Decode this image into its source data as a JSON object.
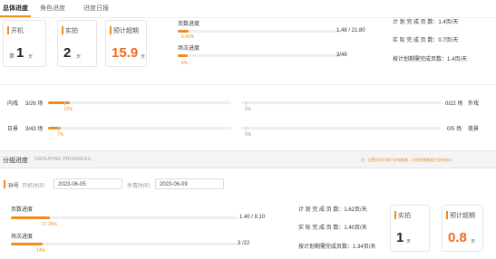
{
  "tabs": [
    "总体进度",
    "角色进度",
    "进度日报"
  ],
  "overview": {
    "card_start": {
      "label": "开机",
      "prefix": "第",
      "value": "1",
      "unit": "天"
    },
    "card_actual": {
      "label": "实拍",
      "value": "2",
      "unit": "天"
    },
    "card_estimate": {
      "label": "预计超期",
      "value": "15.9",
      "unit": "天"
    },
    "page_progress": {
      "label": "页数进度",
      "percent_text": "6.46%",
      "percent": 6.46,
      "count": "1.48 / 21.80"
    },
    "scene_progress": {
      "label": "场次进度",
      "percent_text": "6%",
      "percent": 6,
      "count": "3/48"
    },
    "rates": [
      {
        "label": "计 划 完 成 页 数：",
        "value": "1.4页/天"
      },
      {
        "label": "实 际 完 成 页 数：",
        "value": "0.7页/天"
      },
      {
        "label": "按计划剩需完成页数：",
        "value": "1.4页/天"
      }
    ]
  },
  "timeline": {
    "row1": {
      "left_label": "内戏",
      "left_count": "3/26 场",
      "left_pct_text": "12%",
      "left_pct": 12,
      "right_pct_text": "0%",
      "right_pct": 0,
      "right_count": "0/22 场",
      "right_label": "外戏"
    },
    "row2": {
      "left_label": "日景",
      "left_count": "3/43 场",
      "left_pct_text": "7%",
      "left_pct": 7,
      "right_pct_text": "0%",
      "right_pct": 0,
      "right_count": "0/5 场",
      "right_label": "夜景"
    }
  },
  "grouping": {
    "title": "分组进度",
    "subtitle": "GROUPING PROGRESS",
    "notice": "注：设置开机日期才会有数据，分组完善数据才会有统计",
    "group_name": "孙号",
    "start_label": "开机时间：",
    "start_value": "2023-06-05",
    "end_label": "杀青时间：",
    "end_value": "2023-06-09",
    "page_progress": {
      "label": "页数进度",
      "percent_text": "17.26%",
      "percent": 17.26,
      "count": "1.40 / 8.10"
    },
    "scene_progress": {
      "label": "场次进度",
      "percent_text": "14%",
      "percent": 14,
      "count": "3 /22"
    },
    "rates": [
      {
        "label": "计 划 完 成 页 数：",
        "value": "1.62页/天"
      },
      {
        "label": "实 际 完 成 页 数：",
        "value": "1.40页/天"
      },
      {
        "label": "按计划剩需完成页数：",
        "value": "1.34页/天"
      }
    ],
    "card_actual": {
      "label": "实拍",
      "value": "1",
      "unit": "天"
    },
    "card_estimate": {
      "label": "预计超期",
      "value": "0.8",
      "unit": "天"
    }
  },
  "colors": {
    "accent": "#f08c1e",
    "value_orange": "#f06a1e"
  }
}
